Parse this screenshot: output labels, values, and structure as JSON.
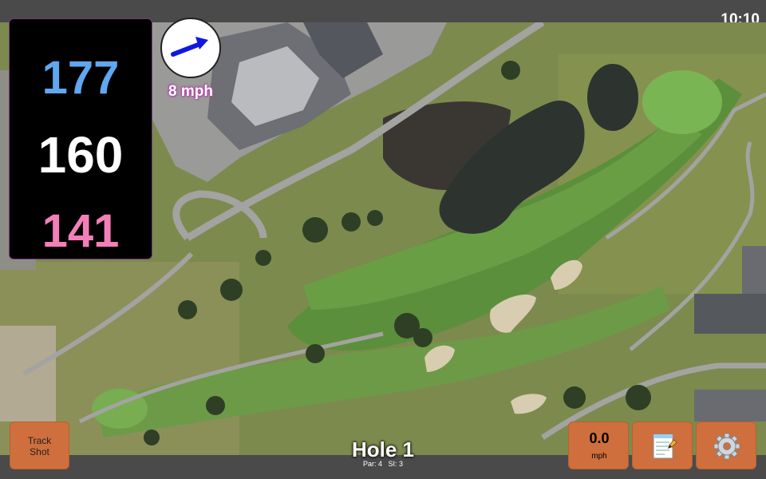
{
  "status": {
    "time": "10:10"
  },
  "distances": {
    "back": "177",
    "middle": "160",
    "front": "141"
  },
  "wind": {
    "speed_label": "8 mph",
    "icon": "arrow-right-icon"
  },
  "buttons": {
    "track_shot_line1": "Track",
    "track_shot_line2": "Shot",
    "speed_value": "0.0",
    "speed_unit": "mph",
    "notes_icon": "notepad-icon",
    "settings_icon": "gear-icon"
  },
  "hole": {
    "title": "Hole 1",
    "par_label": "Par: 4",
    "si_label": "SI: 3"
  },
  "colors": {
    "back_distance": "#5fa8f0",
    "middle_distance": "#ffffff",
    "front_distance": "#f27fb8",
    "button": "#cf6f3d",
    "wind_label_outline": "#b04aa8"
  }
}
